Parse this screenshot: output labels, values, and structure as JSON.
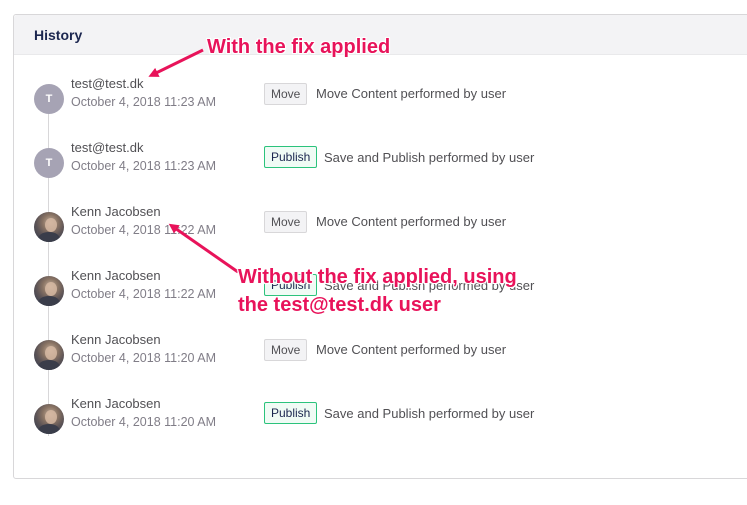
{
  "panel": {
    "title": "History"
  },
  "entries": [
    {
      "avatar_type": "initial",
      "initial": "T",
      "user": "test@test.dk",
      "timestamp": "October 4, 2018 11:23 AM",
      "badge": "Move",
      "badge_type": "move",
      "action": "Move Content performed by user"
    },
    {
      "avatar_type": "initial",
      "initial": "T",
      "user": "test@test.dk",
      "timestamp": "October 4, 2018 11:23 AM",
      "badge": "Publish",
      "badge_type": "publish",
      "action": "Save and Publish performed by user"
    },
    {
      "avatar_type": "photo",
      "initial": "",
      "user": "Kenn Jacobsen",
      "timestamp": "October 4, 2018 11:22 AM",
      "badge": "Move",
      "badge_type": "move",
      "action": "Move Content performed by user"
    },
    {
      "avatar_type": "photo",
      "initial": "",
      "user": "Kenn Jacobsen",
      "timestamp": "October 4, 2018 11:22 AM",
      "badge": "Publish",
      "badge_type": "publish",
      "action": "Save and Publish performed by user"
    },
    {
      "avatar_type": "photo",
      "initial": "",
      "user": "Kenn Jacobsen",
      "timestamp": "October 4, 2018 11:20 AM",
      "badge": "Move",
      "badge_type": "move",
      "action": "Move Content performed by user"
    },
    {
      "avatar_type": "photo",
      "initial": "",
      "user": "Kenn Jacobsen",
      "timestamp": "October 4, 2018 11:20 AM",
      "badge": "Publish",
      "badge_type": "publish",
      "action": "Save and Publish performed by user"
    }
  ],
  "annotations": {
    "top": "With the fix applied",
    "bottom_line1": "Without the fix applied, using",
    "bottom_line2": "the test@test.dk user"
  },
  "colors": {
    "annotation": "#e8135a",
    "publish_border": "#2bc37c",
    "title": "#1b264f"
  }
}
